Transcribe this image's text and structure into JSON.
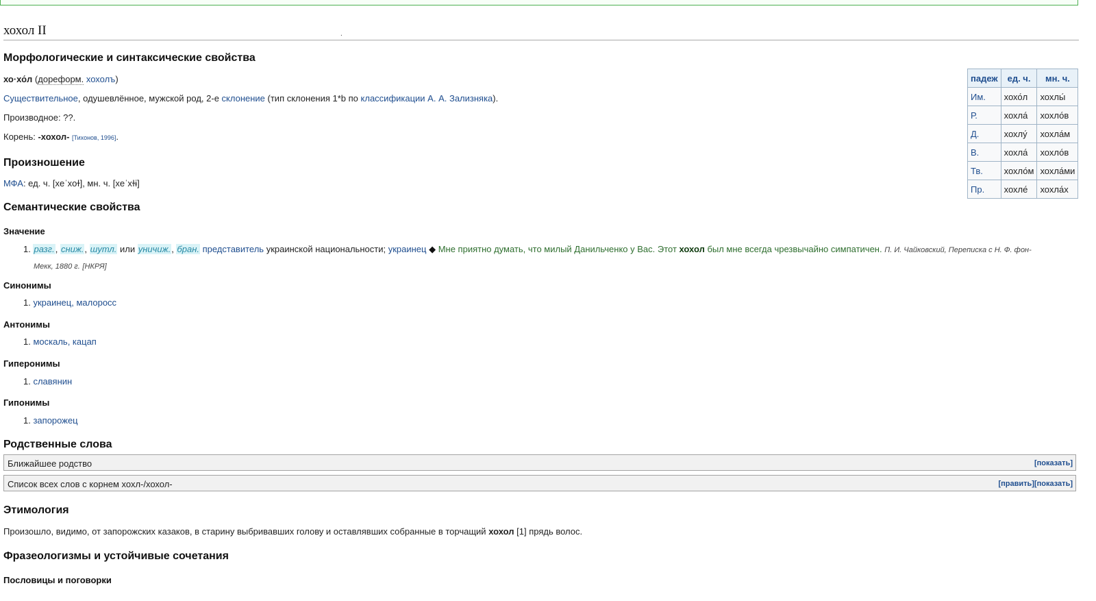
{
  "page": {
    "title": "хохол II",
    "title_dot": "."
  },
  "morph": {
    "heading": "Морфологические и синтаксические свойства",
    "headword": "хо·хо́л",
    "pre_reform_label": "дореформ.",
    "pre_reform_word": "хохолъ",
    "pos_link": "Существительное",
    "pos_text": ", одушевлённое, мужской род, 2-е ",
    "declension_link": "склонение",
    "declension_text": " (тип склонения 1*b по ",
    "classification_link": "классификации А. А. Зализняка",
    "derivative_label": "Производное: ??.",
    "root_label": "Корень: ",
    "root_value": "-хохол-",
    "root_source": "[Тихонов, 1996]"
  },
  "declension_table": {
    "headers": [
      "падеж",
      "ед. ч.",
      "мн. ч."
    ],
    "rows": [
      [
        "Им.",
        "хохо́л",
        "хохлы́"
      ],
      [
        "Р.",
        "хохла́",
        "хохло́в"
      ],
      [
        "Д.",
        "хохлу́",
        "хохла́м"
      ],
      [
        "В.",
        "хохла́",
        "хохло́в"
      ],
      [
        "Тв.",
        "хохло́м",
        "хохла́ми"
      ],
      [
        "Пр.",
        "хохле́",
        "хохла́х"
      ]
    ]
  },
  "pronunciation": {
    "heading": "Произношение",
    "ipa_link": "МФА",
    "text": ": ед. ч. [xeˈxoɫ], мн. ч. [xeˈxɫɨ]"
  },
  "semantic": {
    "heading": "Семантические свойства",
    "meaning_heading": "Значение",
    "meaning_num": "1.",
    "tags": [
      "разг.",
      "сниж.",
      "шутл.",
      "уничиж.",
      "бран."
    ],
    "or_word": "или",
    "definition_link": "представитель",
    "definition_text": " украинской национальности; ",
    "synonym_link": "украинец",
    "example_pre": "Мне приятно думать, что милый Данильченко у Вас. Этот ",
    "example_bold": "хохол",
    "example_post": " был мне всегда чрезвычайно симпатичен.",
    "citation_line1": "П. И. Чайковский, Переписка с Н. Ф. фон-",
    "citation_line2": "Мекк, 1880 г.",
    "citation_source": "[НКРЯ]"
  },
  "relations": [
    {
      "heading": "Синонимы",
      "num": "1.",
      "items": "украинец, малоросс"
    },
    {
      "heading": "Антонимы",
      "num": "1.",
      "items": "москаль, кацап"
    },
    {
      "heading": "Гиперонимы",
      "num": "1.",
      "items": "славянин"
    },
    {
      "heading": "Гипонимы",
      "num": "1.",
      "items": "запорожец"
    }
  ],
  "related_words": {
    "heading": "Родственные слова",
    "box1_title": "Ближайшее родство",
    "box1_action": "[показать]",
    "box2_title": "Список всех слов с корнем хохл-/хохол-",
    "box2_edit": "[править]",
    "box2_action": "[показать]"
  },
  "etymology": {
    "heading": "Этимология",
    "text_pre": "Произошло, видимо, от запорожских казаков, в старину выбривавших голову и оставлявших собранные в торчащий ",
    "text_bold": "хохол",
    "text_ref": " [1]",
    "text_post": " прядь волос."
  },
  "phraseology": {
    "heading": "Фразеологизмы и устойчивые сочетания",
    "proverbs_heading": "Пословицы и поговорки"
  }
}
